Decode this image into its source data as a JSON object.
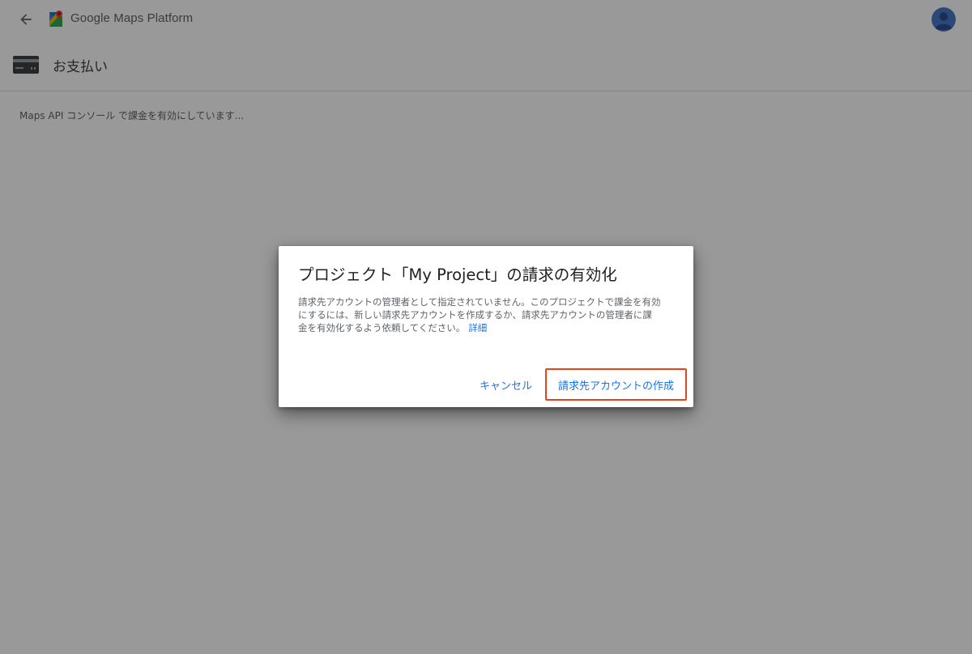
{
  "topbar": {
    "brand": "Google Maps Platform",
    "back_icon": "arrow-back-icon",
    "logo_icon": "google-maps-logo-icon",
    "avatar_icon": "account-avatar-icon"
  },
  "page_header": {
    "icon": "credit-card-icon",
    "title": "お支払い"
  },
  "status_text": "Maps API コンソール で課金を有効にしています...",
  "dialog": {
    "title": "プロジェクト「My Project」の請求の有効化",
    "body": "請求先アカウントの管理者として指定されていません。このプロジェクトで課金を有効にするには、新しい請求先アカウントを作成するか、請求先アカウントの管理者に課金を有効化するよう依頼してください。",
    "link_label": "詳細",
    "cancel_label": "キャンセル",
    "create_label": "請求先アカウントの作成"
  },
  "colors": {
    "accent": "#1a73e8",
    "highlight_border": "#e8441b",
    "scrim": "rgba(0,0,0,0.40)"
  }
}
